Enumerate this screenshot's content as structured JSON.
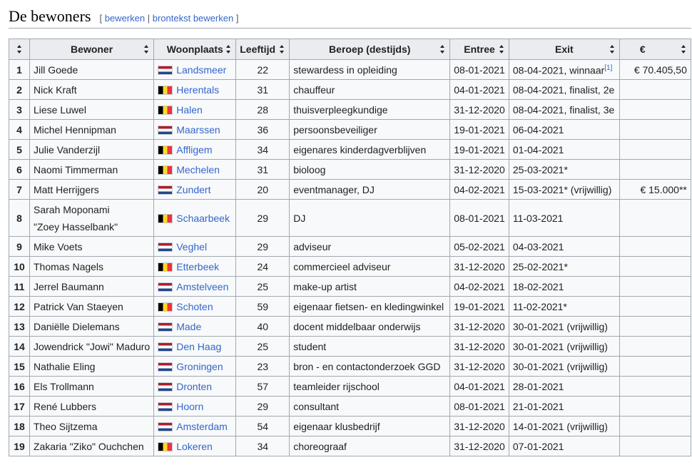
{
  "section": {
    "title": "De bewoners",
    "bracket_open": "[",
    "bracket_close": "]",
    "edit_label": "bewerken",
    "separator": "|",
    "edit_source_label": "brontekst bewerken"
  },
  "table": {
    "headers": [
      "",
      "Bewoner",
      "Woonplaats",
      "Leeftijd",
      "Beroep (destijds)",
      "Entree",
      "Exit",
      "€"
    ],
    "footnote": "[1]",
    "rows": [
      {
        "num": "1",
        "name": "Jill Goede",
        "flag": "nl",
        "place": "Landsmeer",
        "age": "22",
        "job": "stewardess in opleiding",
        "entry": "08-01-2021",
        "exit": "08-04-2021, winnaar",
        "prize": "€ 70.405,50",
        "footnote": true
      },
      {
        "num": "2",
        "name": "Nick Kraft",
        "flag": "be",
        "place": "Herentals",
        "age": "31",
        "job": "chauffeur",
        "entry": "04-01-2021",
        "exit": "08-04-2021, finalist, 2e",
        "prize": ""
      },
      {
        "num": "3",
        "name": "Liese Luwel",
        "flag": "be",
        "place": "Halen",
        "age": "28",
        "job": "thuisverpleegkundige",
        "entry": "31-12-2020",
        "exit": "08-04-2021, finalist, 3e",
        "prize": ""
      },
      {
        "num": "4",
        "name": "Michel Hennipman",
        "flag": "nl",
        "place": "Maarssen",
        "age": "36",
        "job": "persoonsbeveiliger",
        "entry": "19-01-2021",
        "exit": "06-04-2021",
        "prize": ""
      },
      {
        "num": "5",
        "name": "Julie Vanderzijl",
        "flag": "be",
        "place": "Affligem",
        "age": "34",
        "job": "eigenares kinderdagverblijven",
        "entry": "19-01-2021",
        "exit": "01-04-2021",
        "prize": ""
      },
      {
        "num": "6",
        "name": "Naomi Timmerman",
        "flag": "be",
        "place": "Mechelen",
        "age": "31",
        "job": "bioloog",
        "entry": "31-12-2020",
        "exit": "25-03-2021*",
        "prize": ""
      },
      {
        "num": "7",
        "name": "Matt Herrijgers",
        "flag": "nl",
        "place": "Zundert",
        "age": "20",
        "job": "eventmanager, DJ",
        "entry": "04-02-2021",
        "exit": "15-03-2021* (vrijwillig)",
        "prize": "€ 15.000**"
      },
      {
        "num": "8",
        "name": "Sarah Moponami",
        "name2": "\"Zoey Hasselbank\"",
        "flag": "be",
        "place": "Schaarbeek",
        "age": "29",
        "job": "DJ",
        "entry": "08-01-2021",
        "exit": "11-03-2021",
        "prize": ""
      },
      {
        "num": "9",
        "name": "Mike Voets",
        "flag": "nl",
        "place": "Veghel",
        "age": "29",
        "job": "adviseur",
        "entry": "05-02-2021",
        "exit": "04-03-2021",
        "prize": ""
      },
      {
        "num": "10",
        "name": "Thomas Nagels",
        "flag": "be",
        "place": "Etterbeek",
        "age": "24",
        "job": "commercieel adviseur",
        "entry": "31-12-2020",
        "exit": "25-02-2021*",
        "prize": ""
      },
      {
        "num": "11",
        "name": "Jerrel Baumann",
        "flag": "nl",
        "place": "Amstelveen",
        "age": "25",
        "job": "make-up artist",
        "entry": "04-02-2021",
        "exit": "18-02-2021",
        "prize": ""
      },
      {
        "num": "12",
        "name": "Patrick Van Staeyen",
        "flag": "be",
        "place": "Schoten",
        "age": "59",
        "job": "eigenaar fietsen- en kledingwinkel",
        "entry": "19-01-2021",
        "exit": "11-02-2021*",
        "prize": ""
      },
      {
        "num": "13",
        "name": "Daniëlle Dielemans",
        "flag": "nl",
        "place": "Made",
        "age": "40",
        "job": "docent middelbaar onderwijs",
        "entry": "31-12-2020",
        "exit": "30-01-2021 (vrijwillig)",
        "prize": ""
      },
      {
        "num": "14",
        "name": "Jowendrick \"Jowi\" Maduro",
        "flag": "nl",
        "place": "Den Haag",
        "age": "25",
        "job": "student",
        "entry": "31-12-2020",
        "exit": "30-01-2021 (vrijwillig)",
        "prize": ""
      },
      {
        "num": "15",
        "name": "Nathalie Eling",
        "flag": "nl",
        "place": "Groningen",
        "age": "23",
        "job": "bron - en contactonderzoek GGD",
        "entry": "31-12-2020",
        "exit": "30-01-2021 (vrijwillig)",
        "prize": ""
      },
      {
        "num": "16",
        "name": "Els Trollmann",
        "flag": "nl",
        "place": "Dronten",
        "age": "57",
        "job": "teamleider rijschool",
        "entry": "04-01-2021",
        "exit": "28-01-2021",
        "prize": ""
      },
      {
        "num": "17",
        "name": "René Lubbers",
        "flag": "nl",
        "place": "Hoorn",
        "age": "29",
        "job": "consultant",
        "entry": "08-01-2021",
        "exit": "21-01-2021",
        "prize": ""
      },
      {
        "num": "18",
        "name": "Theo Sijtzema",
        "flag": "nl",
        "place": "Amsterdam",
        "age": "54",
        "job": "eigenaar klusbedrijf",
        "entry": "31-12-2020",
        "exit": "14-01-2021 (vrijwillig)",
        "prize": ""
      },
      {
        "num": "19",
        "name": "Zakaria \"Ziko\" Ouchchen",
        "flag": "be",
        "place": "Lokeren",
        "age": "34",
        "job": "choreograaf",
        "entry": "31-12-2020",
        "exit": "07-01-2021",
        "prize": ""
      }
    ]
  }
}
